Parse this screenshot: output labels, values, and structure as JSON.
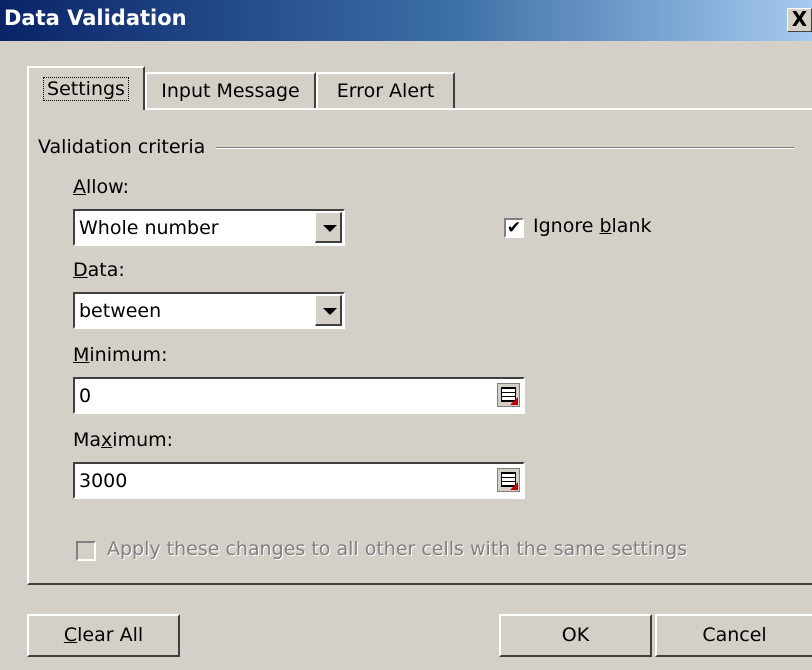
{
  "window": {
    "title": "Data Validation",
    "close_glyph": "X"
  },
  "tabs": [
    {
      "label": "Settings",
      "active": true
    },
    {
      "label": "Input Message",
      "active": false
    },
    {
      "label": "Error Alert",
      "active": false
    }
  ],
  "settings": {
    "group_label": "Validation criteria",
    "allow": {
      "label_mnemonic": "A",
      "label_rest": "llow:",
      "value": "Whole number"
    },
    "ignore_blank": {
      "label_prefix": "Ignore ",
      "label_mnemonic": "b",
      "label_rest": "lank",
      "checked": true,
      "check_glyph": "✔"
    },
    "data": {
      "label_mnemonic": "D",
      "label_rest": "ata:",
      "value": "between"
    },
    "minimum": {
      "label_mnemonic": "M",
      "label_rest": "inimum:",
      "value": "0"
    },
    "maximum": {
      "label_prefix": "Ma",
      "label_mnemonic": "x",
      "label_rest": "imum:",
      "value": "3000"
    },
    "apply_all": {
      "label": "Apply these changes to all other cells with the same settings",
      "checked": false,
      "enabled": false
    }
  },
  "buttons": {
    "clear_all": {
      "mnemonic": "C",
      "rest": "lear All"
    },
    "ok": "OK",
    "cancel": "Cancel"
  }
}
